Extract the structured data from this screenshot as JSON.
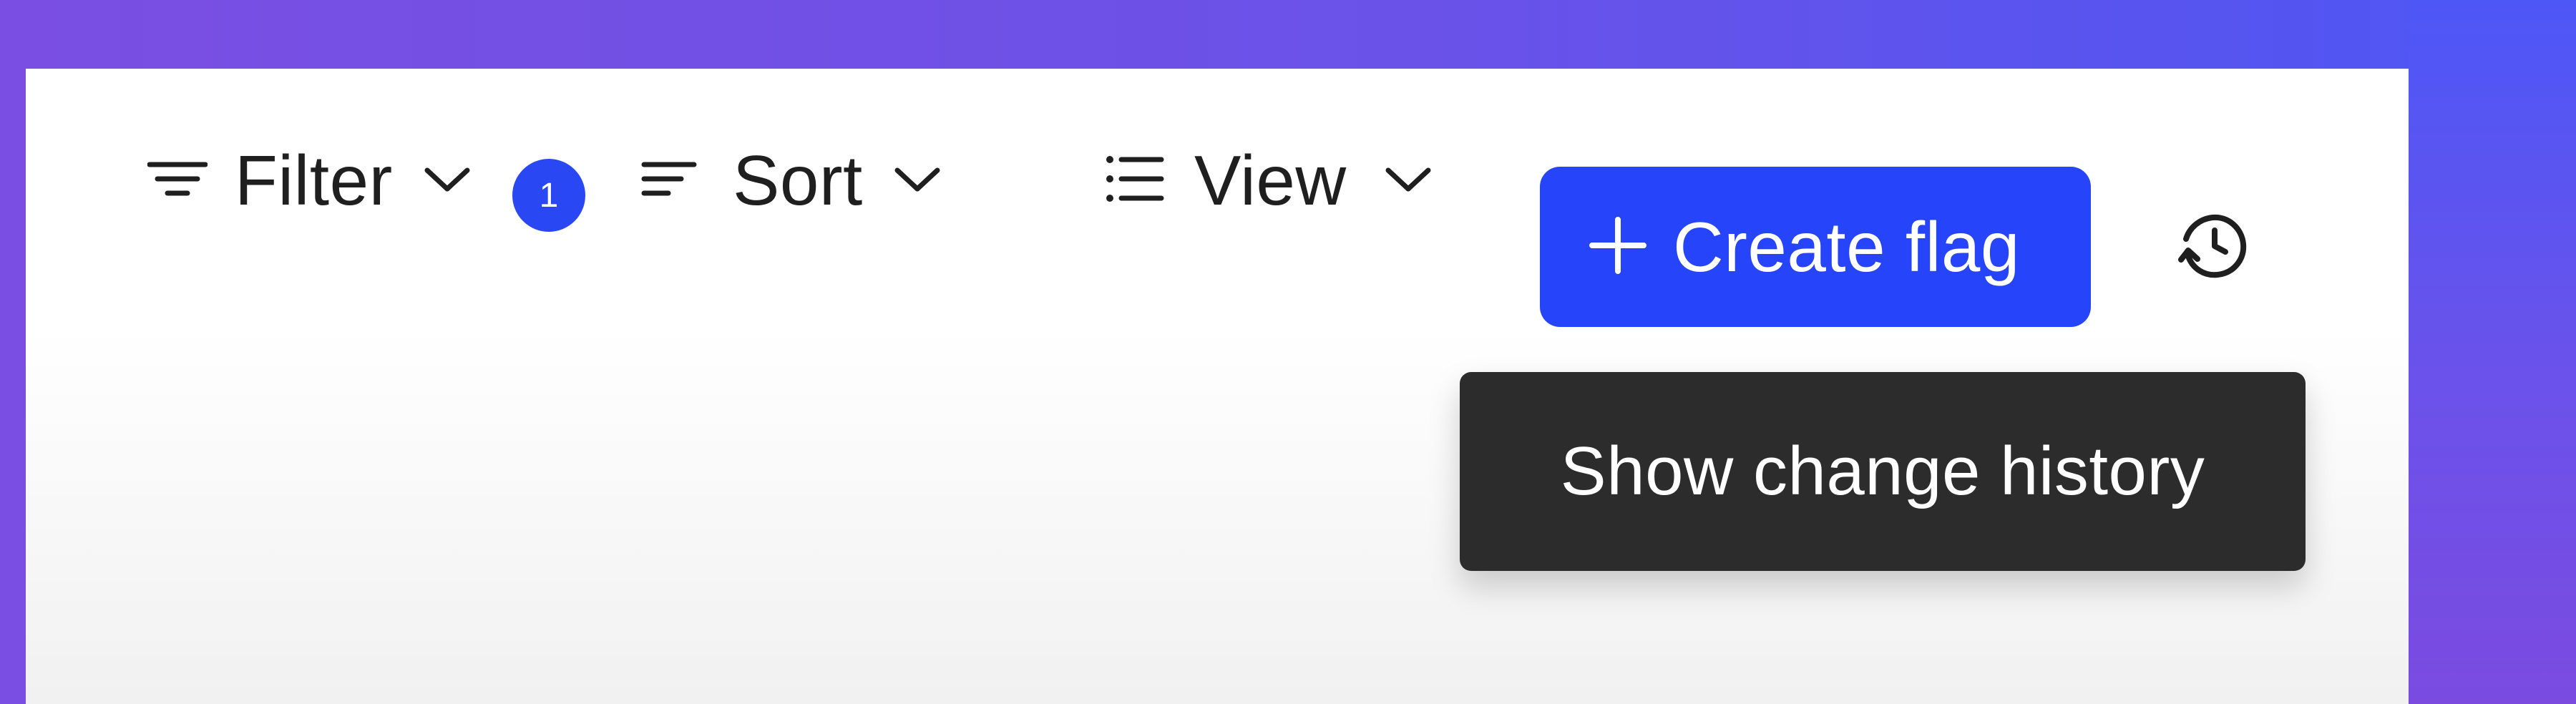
{
  "theme": {
    "accent": "#2645FB",
    "tooltip_background": "#2C2C2C",
    "badge_background": "#2A47F4",
    "text": "#1F1F1F"
  },
  "toolbar": {
    "filter": {
      "label": "Filter",
      "icon": "filter-lines-icon",
      "badge_count": "1",
      "chevron_icon": "chevron-down-icon"
    },
    "sort": {
      "label": "Sort",
      "icon": "sort-lines-icon",
      "chevron_icon": "chevron-down-icon"
    },
    "view": {
      "label": "View",
      "icon": "list-view-icon",
      "chevron_icon": "chevron-down-icon"
    },
    "create": {
      "label": "Create flag",
      "icon": "plus-icon"
    },
    "history": {
      "icon": "history-icon"
    }
  },
  "tooltip": {
    "text": "Show change history"
  }
}
